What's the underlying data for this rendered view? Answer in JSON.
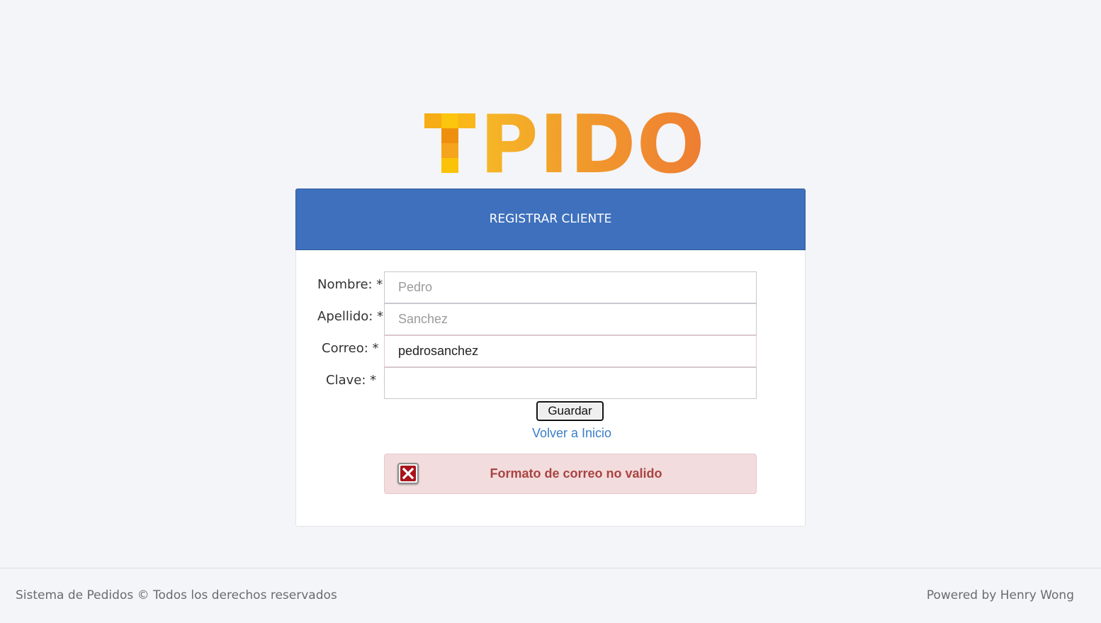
{
  "logo": {
    "text": "TPIDO",
    "letters_rest": "PIDO",
    "colors": [
      "#f6b826",
      "#f19a2c",
      "#ee7d33"
    ]
  },
  "form": {
    "title": "REGISTRAR CLIENTE",
    "header_color": "#3e70bd",
    "fields": [
      {
        "label": "Nombre: *",
        "value": "",
        "placeholder": "Pedro"
      },
      {
        "label": "Apellido: *",
        "value": "",
        "placeholder": "Sanchez"
      },
      {
        "label": "Correo: *",
        "value": "pedrosanchez",
        "placeholder": ""
      },
      {
        "label": "Clave: *",
        "value": "",
        "placeholder": ""
      }
    ],
    "submit_label": "Guardar",
    "back_link": "Volver a Inicio"
  },
  "alert": {
    "icon": "error-x-icon",
    "message": "Formato de correo no valido",
    "color": "#a94442",
    "background": "#f2dcdd"
  },
  "footer": {
    "left": "Sistema de Pedidos © Todos los derechos reservados",
    "right": "Powered by Henry Wong"
  }
}
